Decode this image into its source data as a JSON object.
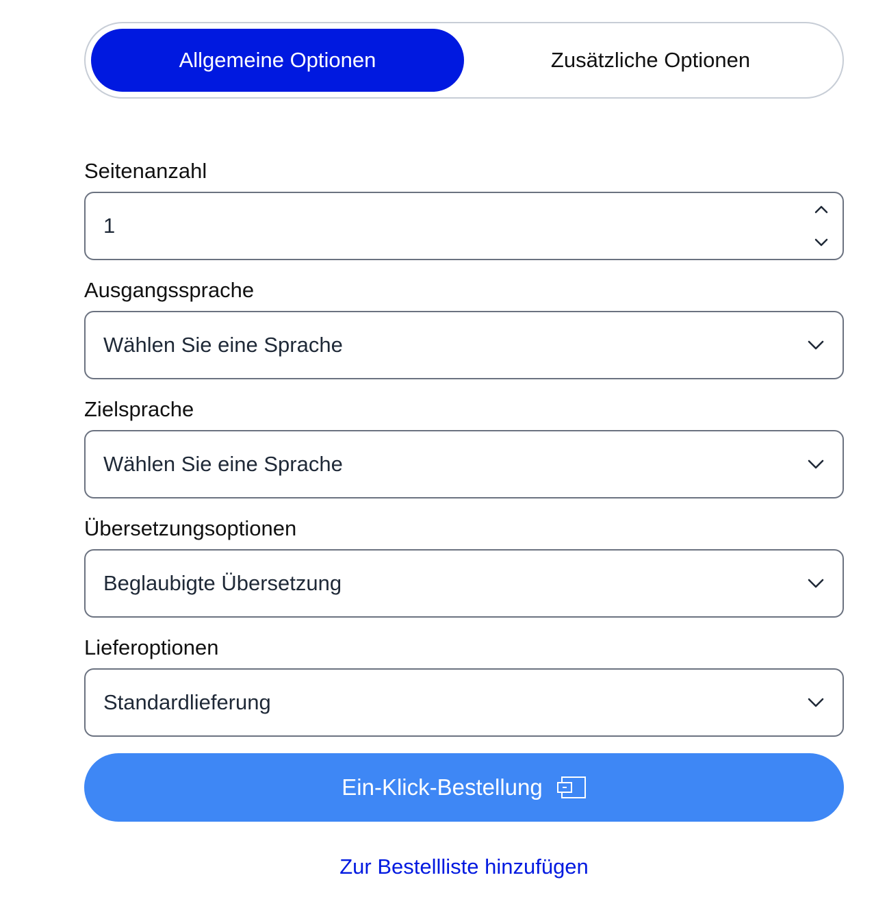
{
  "tabs": [
    {
      "label": "Allgemeine Optionen",
      "active": true
    },
    {
      "label": "Zusätzliche Optionen",
      "active": false
    }
  ],
  "fields": {
    "pages": {
      "label": "Seitenanzahl",
      "value": "1"
    },
    "source_language": {
      "label": "Ausgangssprache",
      "value": "Wählen Sie eine Sprache"
    },
    "target_language": {
      "label": "Zielsprache",
      "value": "Wählen Sie eine Sprache"
    },
    "translation_options": {
      "label": "Übersetzungsoptionen",
      "value": "Beglaubigte Übersetzung"
    },
    "delivery_options": {
      "label": "Lieferoptionen",
      "value": "Standardlieferung"
    }
  },
  "actions": {
    "one_click_order": "Ein-Klick-Bestellung",
    "add_to_order_list": "Zur Bestellliste hinzufügen"
  },
  "colors": {
    "active_tab": "#0019e0",
    "primary_button": "#3e87f5",
    "link": "#0019e0",
    "border": "#6b7280"
  },
  "icons": {
    "stepper_up": "chevron-up-icon",
    "stepper_down": "chevron-down-icon",
    "select": "chevron-down-icon",
    "order": "card-icon"
  }
}
